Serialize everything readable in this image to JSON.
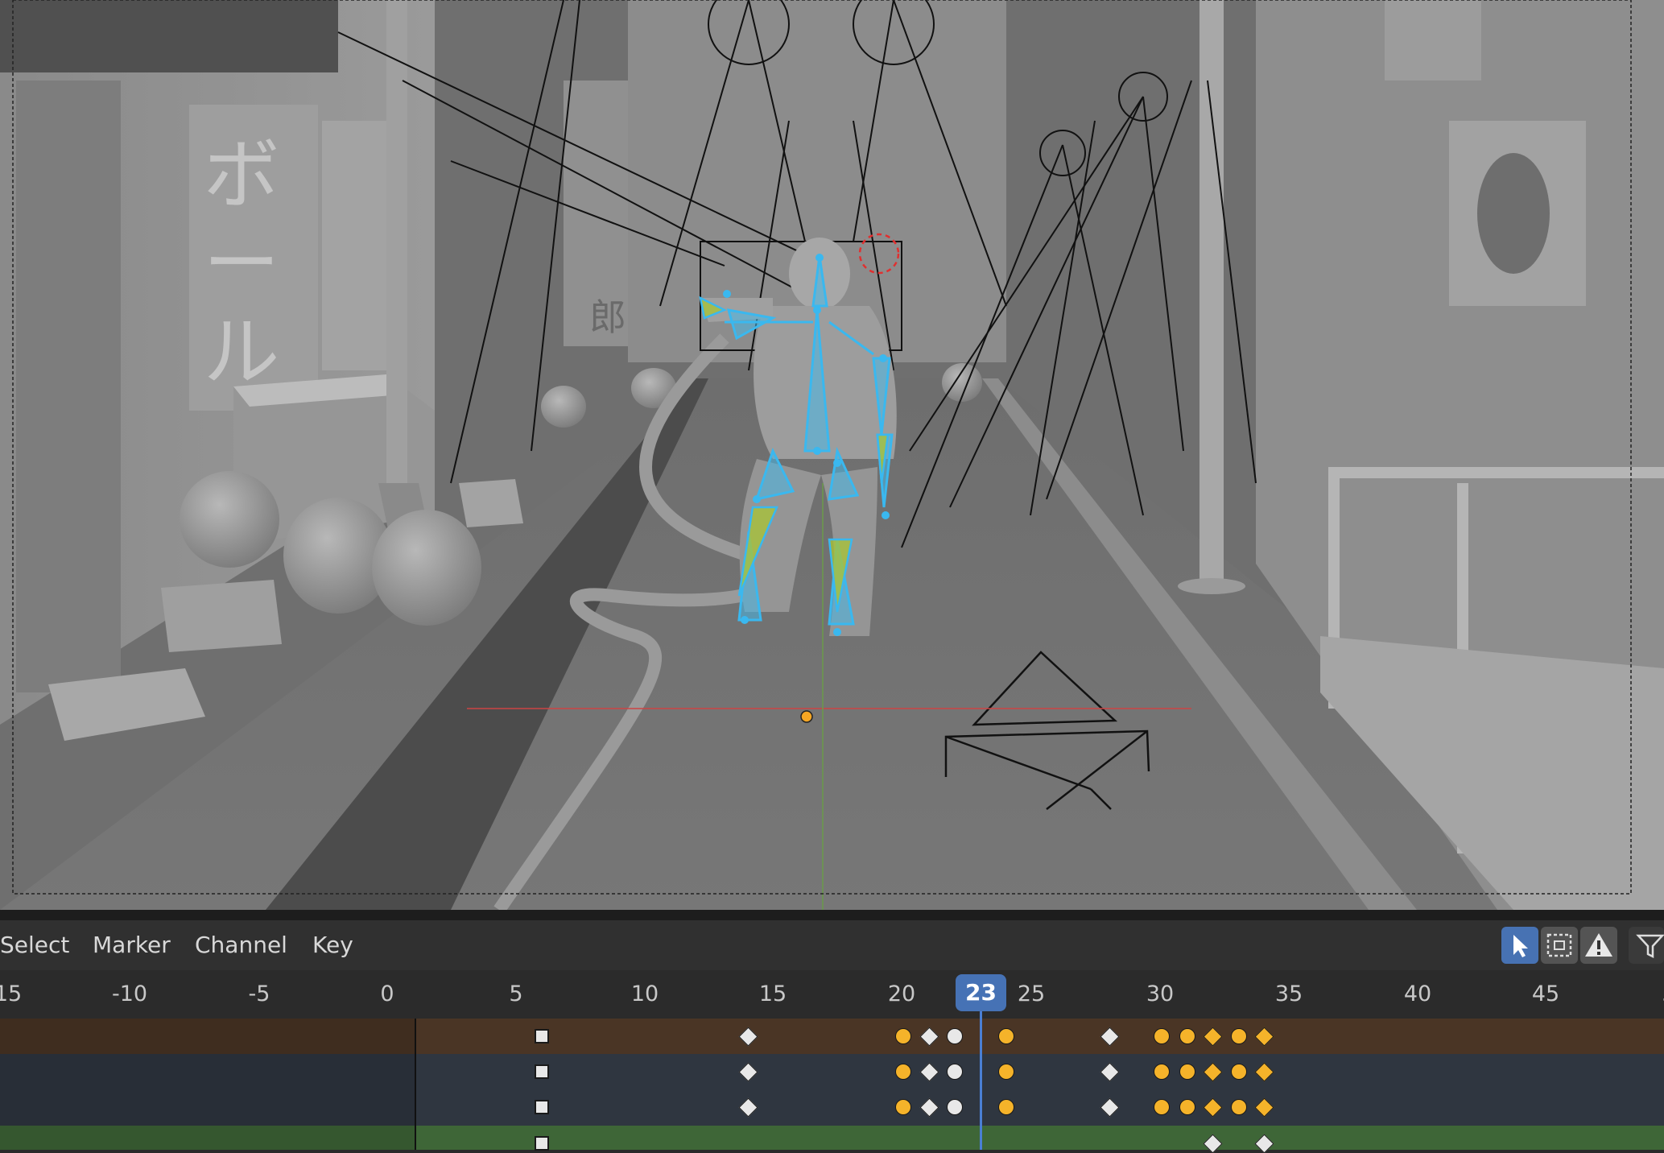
{
  "app": "Blender",
  "menu": {
    "select": "Select",
    "marker": "Marker",
    "channel": "Channel",
    "key": "Key"
  },
  "header_icons": {
    "select_tool": "cursor-arrow-icon",
    "box_select": "box-select-icon",
    "warning": "warning-icon",
    "filter": "filter-icon"
  },
  "timeline": {
    "ruler_ticks": [
      "15",
      "-10",
      "-5",
      "0",
      "5",
      "10",
      "15",
      "20",
      "25",
      "30",
      "35",
      "40",
      "45",
      "5"
    ],
    "current_frame": "23",
    "playhead_frame": 23
  },
  "colors": {
    "selected_key": "#f5b32a",
    "unselected_key": "#e8e8e8",
    "row_summary": "#4a3525",
    "row_channel": "#2f3640",
    "row_action": "#3e6637",
    "playhead": "#4a7fd4",
    "current_frame_bg": "#4672b5",
    "armature_bone": "#47b8e8",
    "armature_bone_selected": "#a8c23a"
  },
  "dopesheet": {
    "rows": [
      {
        "kind": "summary",
        "keys": [
          {
            "frame": 6,
            "type": "square",
            "selected": false
          },
          {
            "frame": 14,
            "type": "diamond",
            "selected": false
          },
          {
            "frame": 20,
            "type": "circle",
            "selected": true
          },
          {
            "frame": 21,
            "type": "diamond",
            "selected": false
          },
          {
            "frame": 22,
            "type": "circle",
            "selected": false
          },
          {
            "frame": 24,
            "type": "circle",
            "selected": true
          },
          {
            "frame": 28,
            "type": "diamond",
            "selected": false
          },
          {
            "frame": 30,
            "type": "circle",
            "selected": true
          },
          {
            "frame": 31,
            "type": "circle",
            "selected": true
          },
          {
            "frame": 32,
            "type": "diamond",
            "selected": true
          },
          {
            "frame": 33,
            "type": "circle",
            "selected": true
          },
          {
            "frame": 34,
            "type": "diamond",
            "selected": true
          }
        ]
      },
      {
        "kind": "channel",
        "keys": [
          {
            "frame": 6,
            "type": "square",
            "selected": false
          },
          {
            "frame": 14,
            "type": "diamond",
            "selected": false
          },
          {
            "frame": 20,
            "type": "circle",
            "selected": true
          },
          {
            "frame": 21,
            "type": "diamond",
            "selected": false
          },
          {
            "frame": 22,
            "type": "circle",
            "selected": false
          },
          {
            "frame": 24,
            "type": "circle",
            "selected": true
          },
          {
            "frame": 28,
            "type": "diamond",
            "selected": false
          },
          {
            "frame": 30,
            "type": "circle",
            "selected": true
          },
          {
            "frame": 31,
            "type": "circle",
            "selected": true
          },
          {
            "frame": 32,
            "type": "diamond",
            "selected": true
          },
          {
            "frame": 33,
            "type": "circle",
            "selected": true
          },
          {
            "frame": 34,
            "type": "diamond",
            "selected": true
          }
        ]
      },
      {
        "kind": "channel",
        "keys": [
          {
            "frame": 6,
            "type": "square",
            "selected": false
          },
          {
            "frame": 14,
            "type": "diamond",
            "selected": false
          },
          {
            "frame": 20,
            "type": "circle",
            "selected": true
          },
          {
            "frame": 21,
            "type": "diamond",
            "selected": false
          },
          {
            "frame": 22,
            "type": "circle",
            "selected": false
          },
          {
            "frame": 24,
            "type": "circle",
            "selected": true
          },
          {
            "frame": 28,
            "type": "diamond",
            "selected": false
          },
          {
            "frame": 30,
            "type": "circle",
            "selected": true
          },
          {
            "frame": 31,
            "type": "circle",
            "selected": true
          },
          {
            "frame": 32,
            "type": "diamond",
            "selected": true
          },
          {
            "frame": 33,
            "type": "circle",
            "selected": true
          },
          {
            "frame": 34,
            "type": "diamond",
            "selected": true
          }
        ]
      },
      {
        "kind": "action",
        "keys": [
          {
            "frame": 6,
            "type": "square",
            "selected": false
          },
          {
            "frame": 32,
            "type": "diamond",
            "selected": false
          },
          {
            "frame": 34,
            "type": "diamond",
            "selected": false
          }
        ]
      }
    ]
  },
  "scene": {
    "signs": [
      "ボ",
      "ー",
      "ル",
      "郎"
    ]
  }
}
